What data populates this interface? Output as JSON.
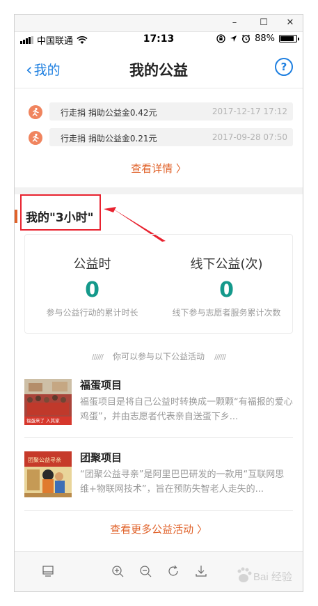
{
  "window": {
    "minimize_glyph": "–",
    "maximize_glyph": "☐",
    "close_glyph": "✕"
  },
  "status_bar": {
    "carrier": "中国联通",
    "time": "17:13",
    "battery_percent": "88%",
    "battery_level": 0.88
  },
  "nav": {
    "back_label": "我的",
    "title": "我的公益",
    "help_label": "?"
  },
  "records": [
    {
      "text": "行走捐  捐助公益金0.42元",
      "time": "2017-12-17 17:12"
    },
    {
      "text": "行走捐  捐助公益金0.21元",
      "time": "2017-09-28 07:50"
    }
  ],
  "detail_link": "查看详情 〉",
  "section_title": "我的\"3小时\"",
  "stats": {
    "hours": {
      "label": "公益时",
      "value": "0",
      "desc": "参与公益行动的累计时长"
    },
    "offline": {
      "label": "线下公益(次)",
      "value": "0",
      "desc": "线下参与志愿者服务累计次数"
    }
  },
  "activity_hint": "你可以参与以下公益活动",
  "hint_deco": "//////",
  "projects": [
    {
      "name": "福蛋项目",
      "desc": "福蛋项目是将自己公益时转换成一颗颗“有福报的爱心鸡蛋”，并由志愿者代表亲自送蛋下乡...",
      "thumb_caption": "福蛋来了 入其家"
    },
    {
      "name": "团聚项目",
      "desc": "“团聚公益寻亲”是阿里巴巴研发的一款用“互联网思维+物联网技术”，旨在预防失智老人走失的...",
      "thumb_caption": "团聚公益寻亲"
    }
  ],
  "more_link": "查看更多公益活动 〉",
  "toolbar": [
    "screen-icon",
    "zoom-in-icon",
    "zoom-out-icon",
    "rotate-icon",
    "download-icon"
  ],
  "watermark": "Bai 经验",
  "colors": {
    "accent_blue": "#1e7fe0",
    "accent_orange": "#e0622a",
    "stat_teal": "#14998b",
    "annotation_red": "#e8222f"
  }
}
